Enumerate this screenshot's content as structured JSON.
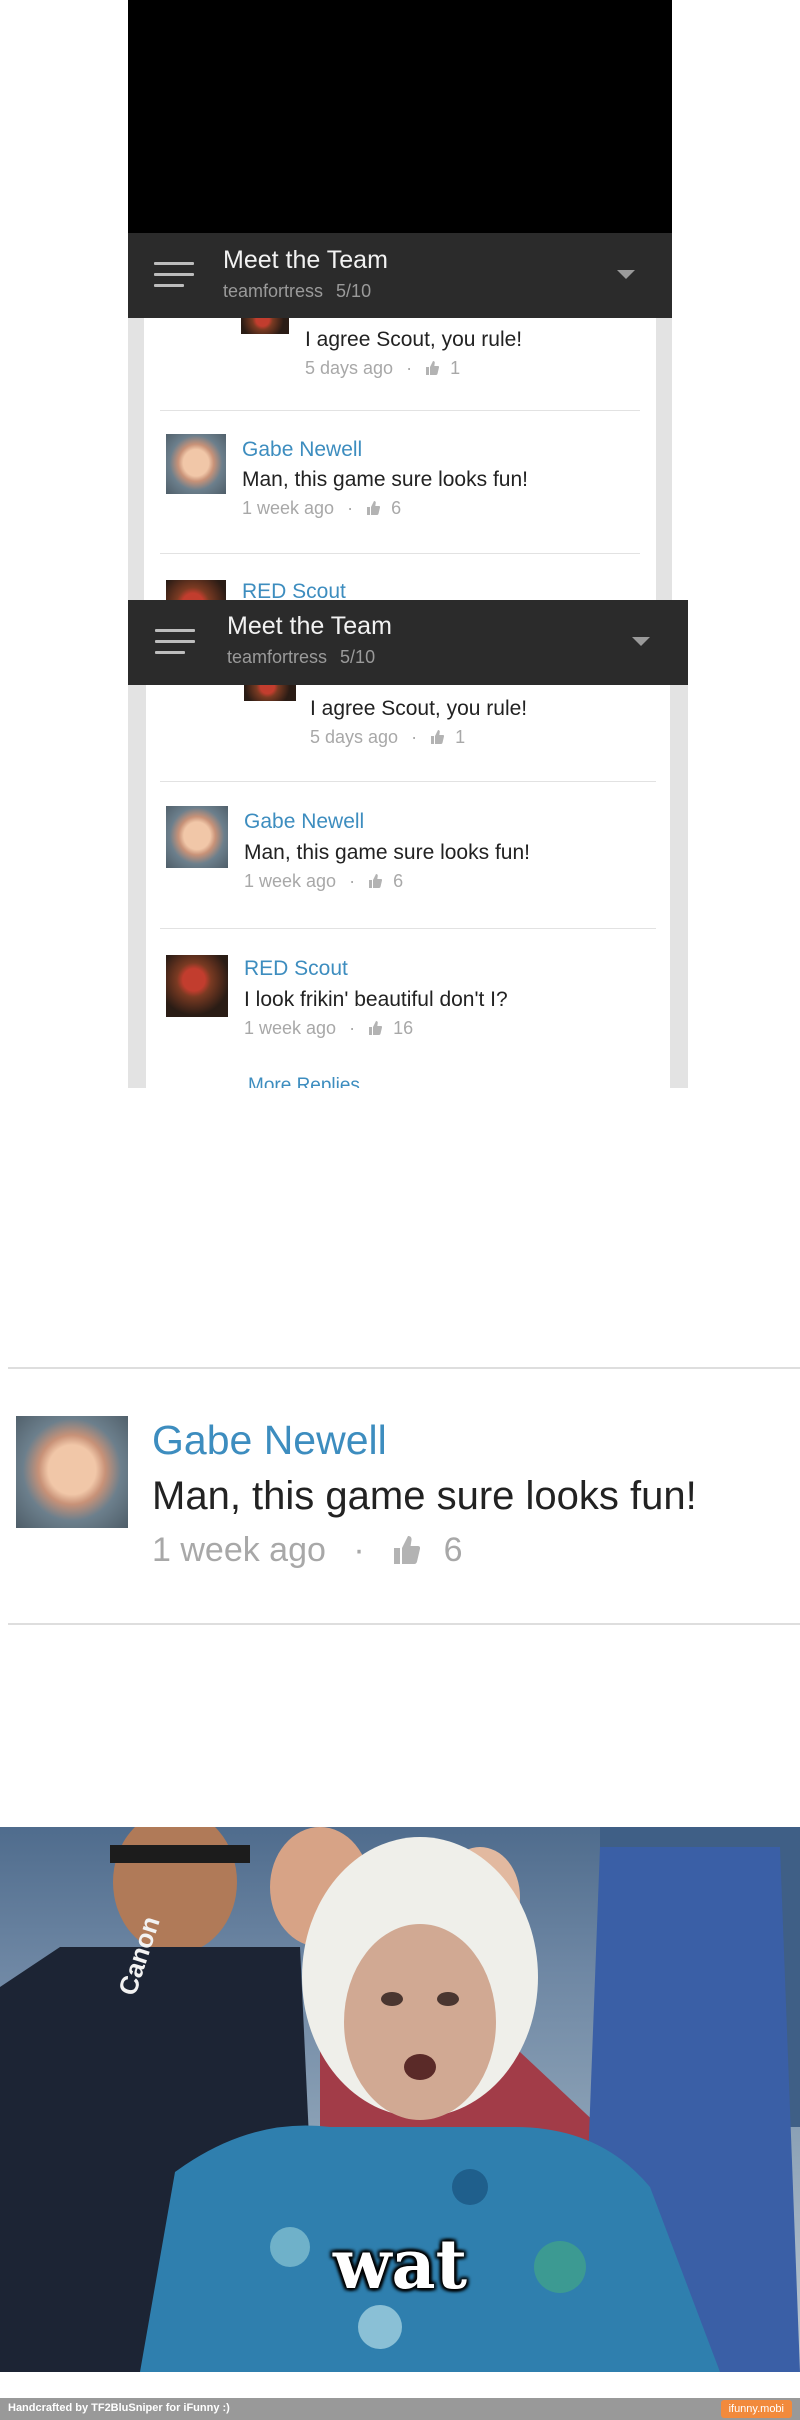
{
  "header": {
    "title": "Meet the Team",
    "channel": "teamfortress",
    "position": "5/10"
  },
  "comments": {
    "c1": {
      "text": "I agree Scout, you rule!",
      "age": "5 days ago",
      "likes": "1"
    },
    "c2": {
      "author": "Gabe Newell",
      "text": "Man, this game sure looks fun!",
      "age": "1 week ago",
      "likes": "6"
    },
    "c3": {
      "author": "RED Scout",
      "text": "I look frikin' beautiful don't I?",
      "age": "1 week ago",
      "likes": "16"
    },
    "more_replies": "More Replies"
  },
  "separator": "·",
  "meme": {
    "caption": "wat",
    "shirt_text": "Canon"
  },
  "footer": {
    "credit": "Handcrafted by TF2BluSniper for iFunny :)",
    "logo": "ifunny.mobi"
  },
  "colors": {
    "author_link": "#3d8dbf",
    "bar": "#2b2b2b",
    "footer_logo": "#f28a3c"
  }
}
